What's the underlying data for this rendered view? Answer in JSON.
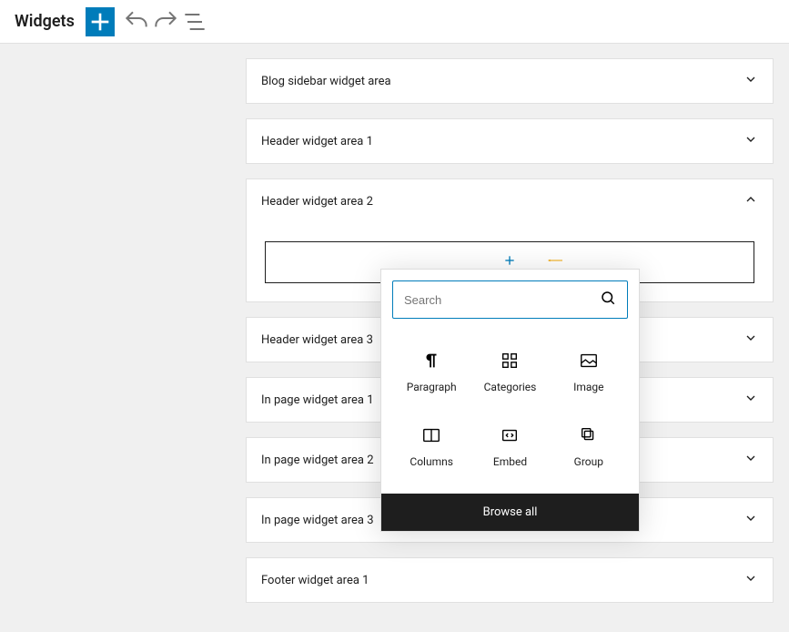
{
  "header": {
    "title": "Widgets"
  },
  "widget_areas": [
    {
      "label": "Blog sidebar widget area",
      "expanded": false
    },
    {
      "label": "Header widget area 1",
      "expanded": false
    },
    {
      "label": "Header widget area 2",
      "expanded": true
    },
    {
      "label": "Header widget area 3",
      "expanded": false
    },
    {
      "label": "In page widget area 1",
      "expanded": false
    },
    {
      "label": "In page widget area 2",
      "expanded": false
    },
    {
      "label": "In page widget area 3",
      "expanded": false
    },
    {
      "label": "Footer widget area 1",
      "expanded": false
    }
  ],
  "inserter": {
    "search_placeholder": "Search",
    "blocks": [
      {
        "name": "Paragraph"
      },
      {
        "name": "Categories"
      },
      {
        "name": "Image"
      },
      {
        "name": "Columns"
      },
      {
        "name": "Embed"
      },
      {
        "name": "Group"
      }
    ],
    "browse_all": "Browse all"
  }
}
